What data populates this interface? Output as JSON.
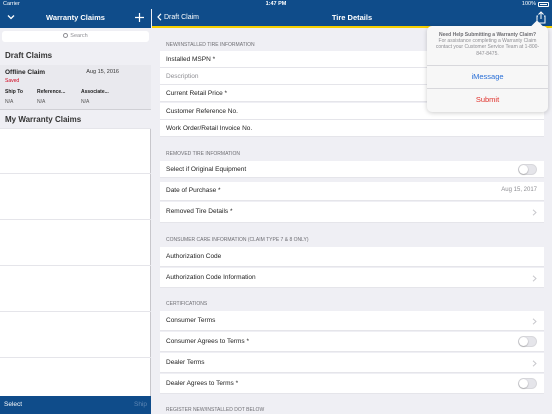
{
  "status_bar": {
    "carrier": "Carrier",
    "time": "1:47 PM",
    "battery": "100%"
  },
  "left_pane": {
    "title": "Warranty Claims",
    "search_placeholder": "Search",
    "draft_section": "Draft Claims",
    "draft_item": {
      "name": "Offline Claim",
      "date": "Aug 15, 2016",
      "status": "Saved",
      "columns": [
        {
          "header": "Ship To",
          "value": "N/A"
        },
        {
          "header": "Reference...",
          "value": "N/A"
        },
        {
          "header": "Associate...",
          "value": "N/A"
        }
      ]
    },
    "my_section": "My Warranty Claims",
    "bottom": {
      "select": "Select",
      "ship": "Ship"
    }
  },
  "right_pane": {
    "back_label": "Draft Claim",
    "title": "Tire Details",
    "groups": {
      "new_tire": "NEW/INSTALLED TIRE INFORMATION",
      "removed_tire": "REMOVED TIRE INFORMATION",
      "consumer_care": "CONSUMER CARE INFORMATION (CLAIM TYPE 7 & 8 ONLY)",
      "certifications": "CERTIFICATIONS",
      "register": "REGISTER NEW/INSTALLED DOT BELOW"
    },
    "rows": {
      "installed_mspn": "Installed MSPN *",
      "description": "Description",
      "retail_price": "Current Retail Price *",
      "customer_ref": "Customer Reference No.",
      "work_order": "Work Order/Retail Invoice No.",
      "original_equipment": "Select if Original Equipment",
      "date_purchase": "Date of Purchase *",
      "date_purchase_value": "Aug 15, 2017",
      "removed_details": "Removed Tire Details *",
      "auth_code": "Authorization Code",
      "auth_code_info": "Authorization Code Information",
      "consumer_terms": "Consumer Terms",
      "consumer_agrees": "Consumer Agrees to Terms *",
      "dealer_terms": "Dealer Terms",
      "dealer_agrees": "Dealer Agrees to Terms *"
    }
  },
  "popover": {
    "title": "Need Help Submitting a Warranty Claim?",
    "body": "For assistance completing a Warranty Claim contact your Customer Service Team at 1-800-847-8475.",
    "imessage": "iMessage",
    "submit": "Submit"
  },
  "colors": {
    "nav_bar": "#0f4c8a",
    "accent_stripe": "#f7d000",
    "link": "#2a6fd6",
    "destructive": "#e0302a",
    "saved_status": "#d0021b"
  },
  "icons": {
    "collapse": "chevron-down-icon",
    "add": "plus-icon",
    "search": "search-icon",
    "back": "chevron-left-icon",
    "share": "share-icon",
    "disclosure": "chevron-right-icon"
  }
}
